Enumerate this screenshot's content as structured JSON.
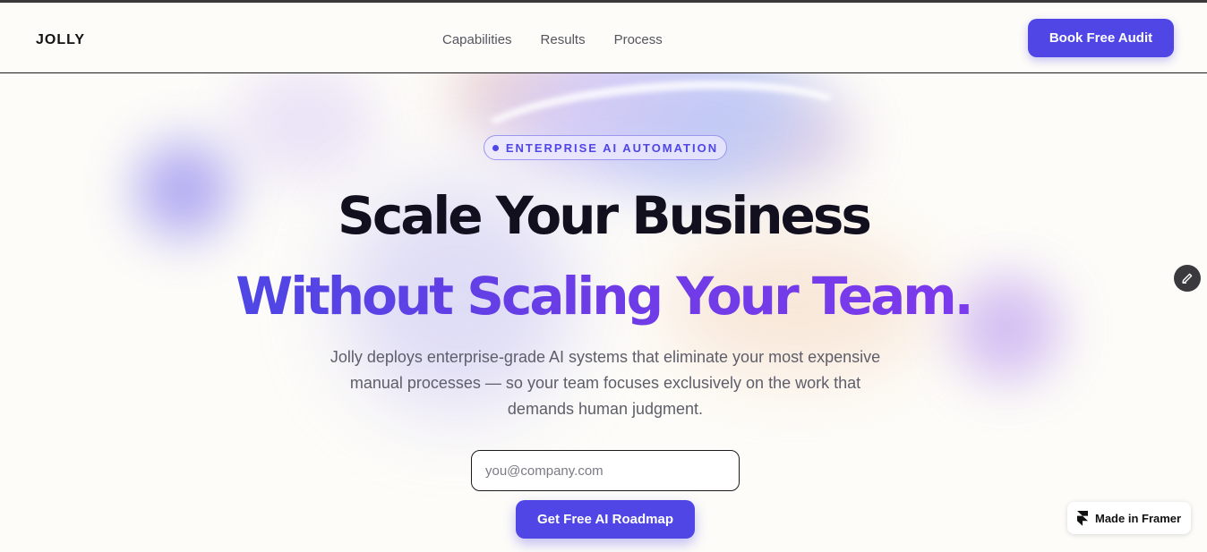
{
  "nav": {
    "logo": "JOLLY",
    "links": [
      "Capabilities",
      "Results",
      "Process"
    ],
    "cta_label": "Book Free Audit"
  },
  "hero": {
    "badge": "ENTERPRISE AI AUTOMATION",
    "headline_line1": "Scale Your Business",
    "headline_line2": "Without Scaling Your Team.",
    "subheadline": "Jolly deploys enterprise-grade AI systems that eliminate your most expensive manual processes — so your team focuses exclusively on the work that demands human judgment.",
    "email_placeholder": "you@company.com",
    "cta_label": "Get Free AI Roadmap"
  },
  "framer_badge": {
    "label": "Made in Framer"
  },
  "colors": {
    "accent": "#4f46e5",
    "accent_purple": "#7c3aed",
    "background": "#fdfcf8"
  },
  "icons": [
    "pencil-icon",
    "framer-logo-icon"
  ]
}
